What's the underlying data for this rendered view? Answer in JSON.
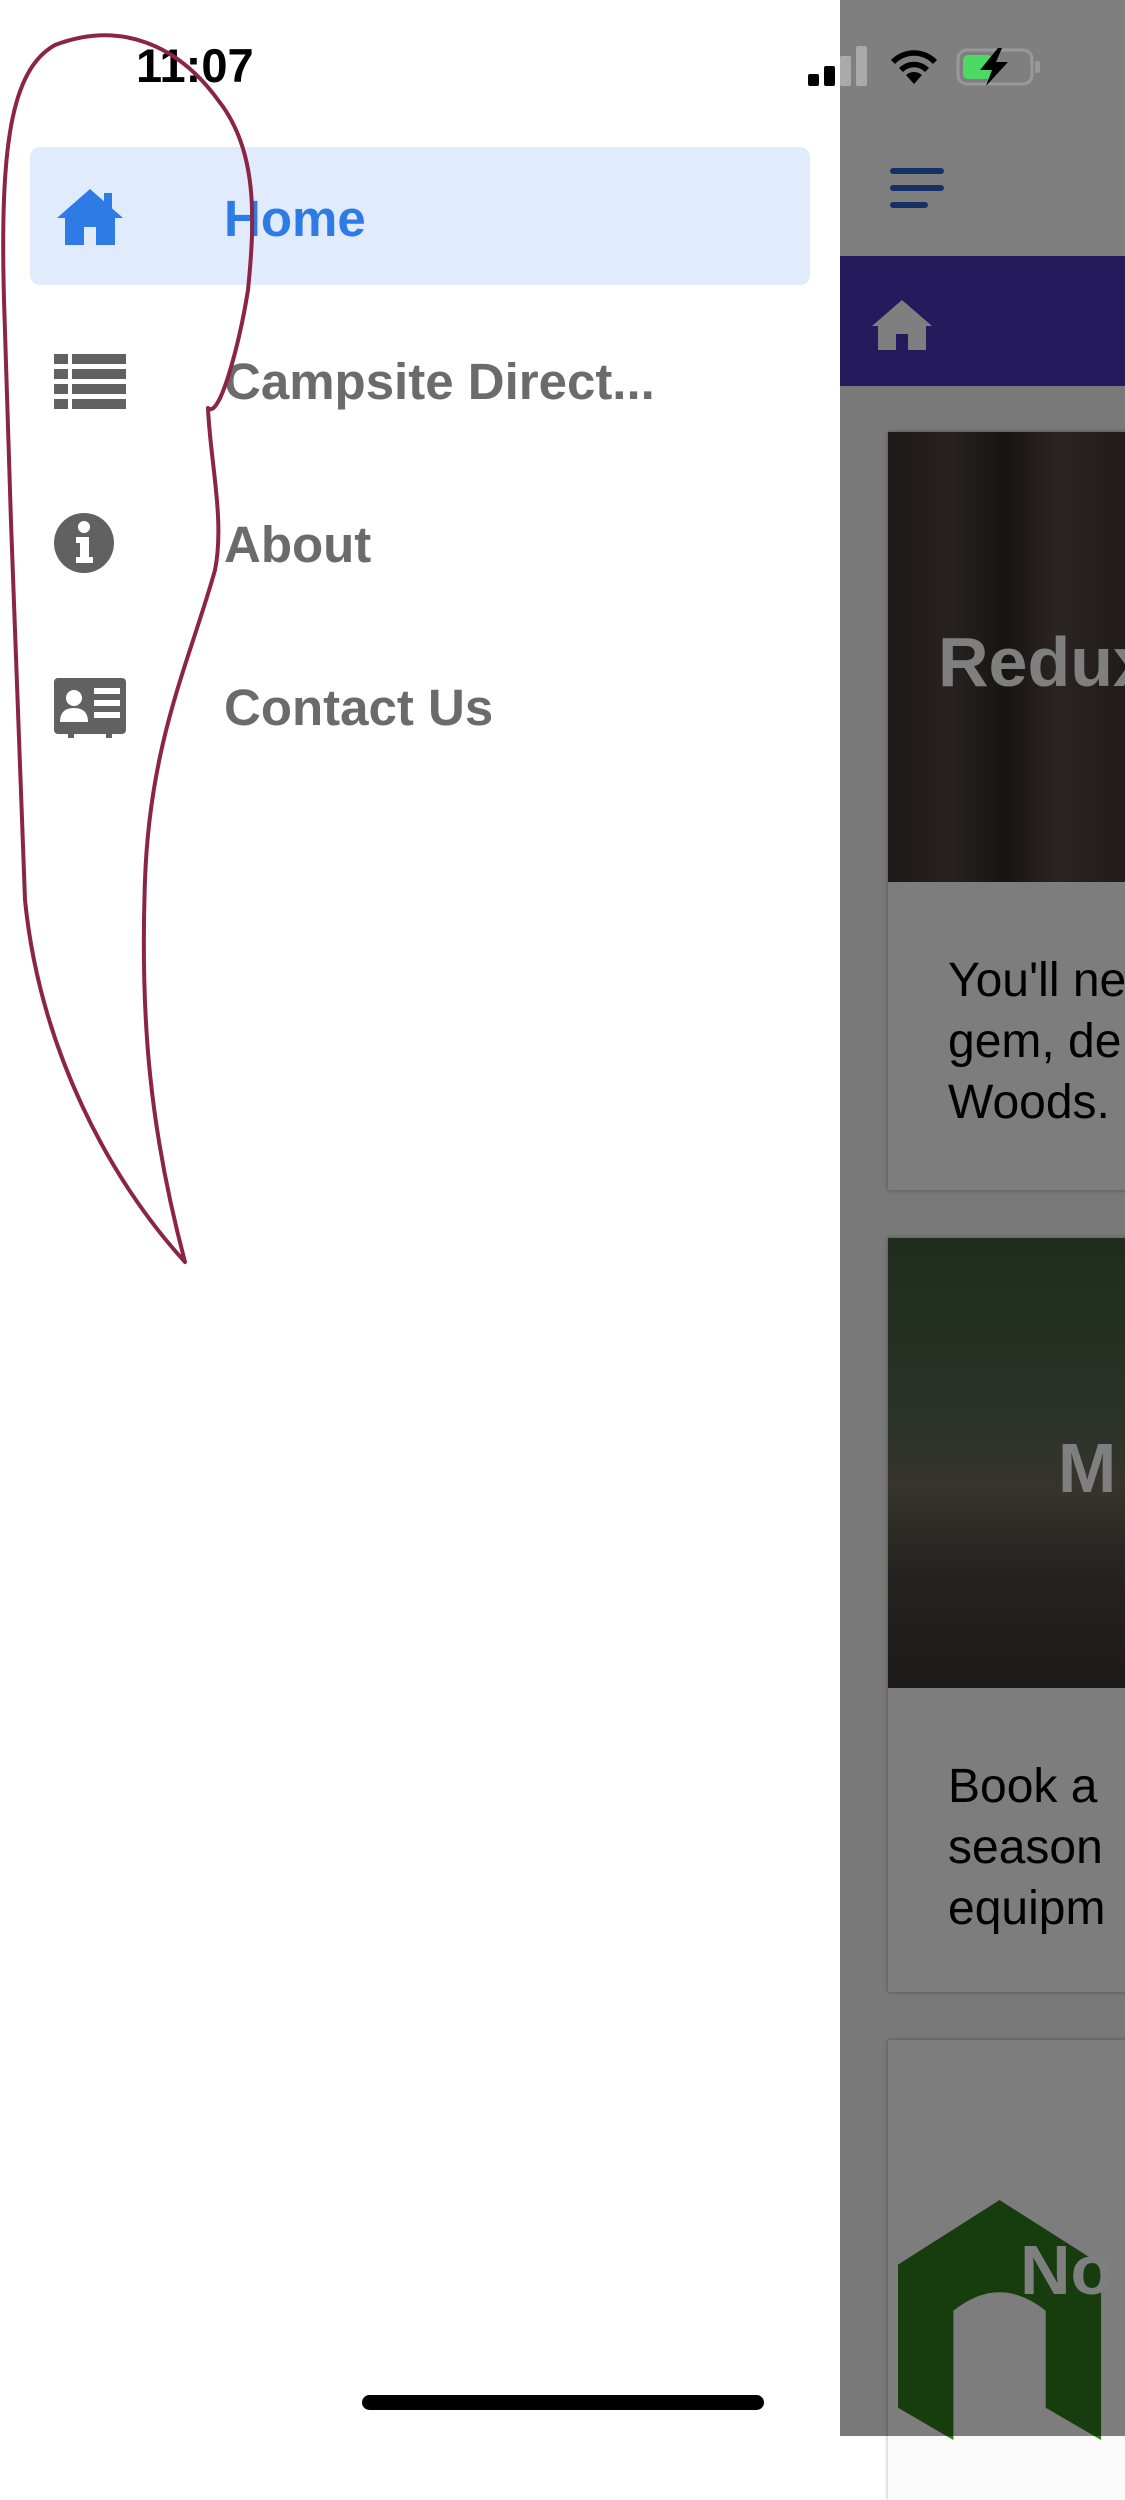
{
  "status_bar": {
    "time": "11:07"
  },
  "drawer": {
    "items": [
      {
        "label": "Home",
        "icon": "home-icon",
        "active": true
      },
      {
        "label": "Campsite Direct...",
        "icon": "list-icon",
        "active": false
      },
      {
        "label": "About",
        "icon": "info-circle-icon",
        "active": false
      },
      {
        "label": "Contact Us",
        "icon": "address-card-icon",
        "active": false
      }
    ]
  },
  "background_app": {
    "header_bar_color": "#4a37b8",
    "cards": [
      {
        "image_title": "Redux",
        "description": "You'll ne\ngem, de\nWoods."
      },
      {
        "image_title": "M",
        "description": "Book a \nseason\nequipm"
      },
      {
        "image_title": "No"
      }
    ]
  },
  "colors": {
    "accent": "#2f7be5",
    "active_bg": "#e0ebfd",
    "inactive_text": "#6b6b6b",
    "annotation": "#8a2547"
  }
}
